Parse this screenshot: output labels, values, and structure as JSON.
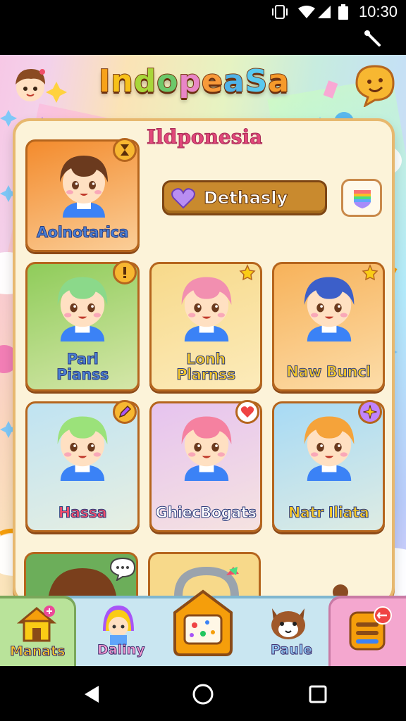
{
  "status_bar": {
    "time": "10:30"
  },
  "game": {
    "title": "IndopeaSa",
    "title_letters": [
      {
        "ch": "I",
        "color": "#f7a21a"
      },
      {
        "ch": "n",
        "color": "#f7c11a"
      },
      {
        "ch": "d",
        "color": "#a8d63a"
      },
      {
        "ch": "o",
        "color": "#6cc86a"
      },
      {
        "ch": "p",
        "color": "#e886c7"
      },
      {
        "ch": "e",
        "color": "#f79a3a"
      },
      {
        "ch": "a",
        "color": "#4fb3e8"
      },
      {
        "ch": "S",
        "color": "#58c9f0"
      },
      {
        "ch": "a",
        "color": "#f59a2a"
      }
    ]
  },
  "panel": {
    "title": "Ildponesia",
    "featured_label": "Dethasly"
  },
  "characters": [
    {
      "name": [
        "Aolnotarica"
      ],
      "name_color": "#4a7fd4",
      "hair": "#6b3a1e",
      "bg": "#f38b2d",
      "badge_icon": "hourglass-icon"
    },
    {
      "name": [
        "Parl",
        "Pianss"
      ],
      "name_color": "#4a7fd4",
      "hair": "#8bd98a",
      "bg": "#8fcc5a",
      "badge_icon": "exclamation-icon"
    },
    {
      "name": [
        "Lonh",
        "Plarnss"
      ],
      "name_color": "#f5c72a",
      "hair": "#f28fb0",
      "bg": "#f7d98a",
      "badge_icon": "star-icon"
    },
    {
      "name": [
        "Naw Buncl"
      ],
      "name_color": "#f5c72a",
      "hair": "#3c5fc9",
      "bg": "#f7b25a",
      "badge_icon": "star-icon"
    },
    {
      "name": [
        "Hassa"
      ],
      "name_color": "#ef4e6b",
      "hair": "#9be27a",
      "bg": "#bfe3f2",
      "badge_icon": "pencil-icon"
    },
    {
      "name": [
        "GhiecBogats"
      ],
      "name_color": "#ffffff",
      "hair": "#f581a0",
      "bg": "#e6c3ef",
      "badge_icon": "heart-icon"
    },
    {
      "name": [
        "Natr Iliata"
      ],
      "name_color": "#f5c72a",
      "hair": "#f5a33a",
      "bg": "#a7daf5",
      "badge_icon": "plus-icon"
    }
  ],
  "bottom_nav": {
    "items": [
      {
        "label": "Manats",
        "color": "#f5c72a"
      },
      {
        "label": "Daliny",
        "color": "#f29ad0"
      },
      {
        "label": "Paule",
        "color": "#8ec6f0"
      }
    ]
  }
}
